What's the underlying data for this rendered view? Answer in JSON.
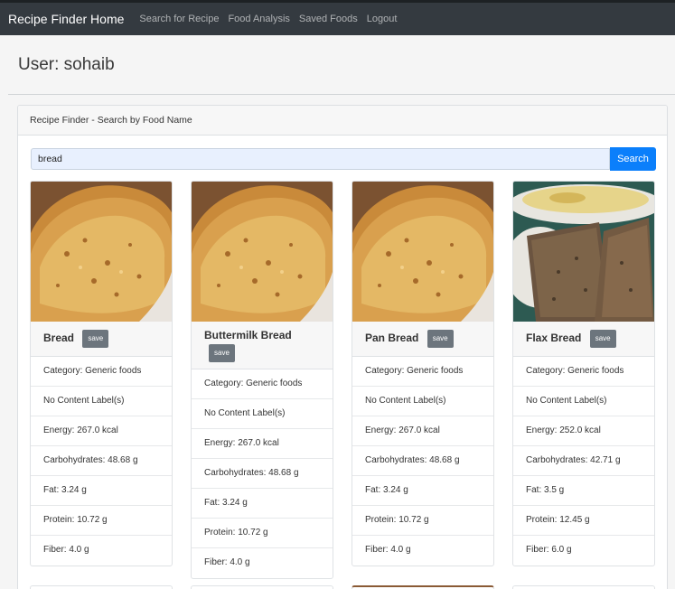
{
  "nav": {
    "brand": "Recipe Finder Home",
    "links": [
      "Search for Recipe",
      "Food Analysis",
      "Saved Foods",
      "Logout"
    ]
  },
  "user_heading": "User: sohaib",
  "panel": {
    "header": "Recipe Finder - Search by Food Name",
    "search_value": "bread",
    "search_button": "Search"
  },
  "cards": [
    {
      "title": "Bread",
      "save": "save",
      "rows": [
        "Category: Generic foods",
        "No Content Label(s)",
        "Energy: 267.0 kcal",
        "Carbohydrates: 48.68 g",
        "Fat: 3.24 g",
        "Protein: 10.72 g",
        "Fiber: 4.0 g"
      ]
    },
    {
      "title": "Buttermilk Bread",
      "save": "save",
      "rows": [
        "Category: Generic foods",
        "No Content Label(s)",
        "Energy: 267.0 kcal",
        "Carbohydrates: 48.68 g",
        "Fat: 3.24 g",
        "Protein: 10.72 g",
        "Fiber: 4.0 g"
      ]
    },
    {
      "title": "Pan Bread",
      "save": "save",
      "rows": [
        "Category: Generic foods",
        "No Content Label(s)",
        "Energy: 267.0 kcal",
        "Carbohydrates: 48.68 g",
        "Fat: 3.24 g",
        "Protein: 10.72 g",
        "Fiber: 4.0 g"
      ]
    },
    {
      "title": "Flax Bread",
      "save": "save",
      "rows": [
        "Category: Generic foods",
        "No Content Label(s)",
        "Energy: 252.0 kcal",
        "Carbohydrates: 42.71 g",
        "Fat: 3.5 g",
        "Protein: 12.45 g",
        "Fiber: 6.0 g"
      ]
    }
  ],
  "colors": {
    "navbar": "#343a40",
    "primary": "#0b7ffb",
    "secondary": "#6c757d"
  }
}
